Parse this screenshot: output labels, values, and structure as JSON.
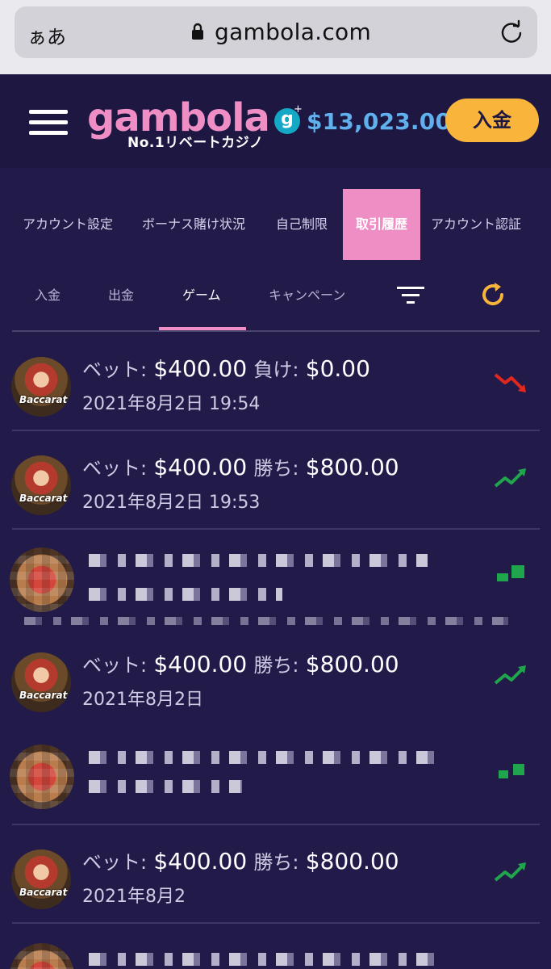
{
  "browser": {
    "text_size": "ぁあ",
    "url": "gambola.com"
  },
  "header": {
    "logo": "gambola",
    "tagline": "No.1リベートカジノ",
    "coin_letter": "g",
    "balance": "$13,023.00",
    "deposit_label": "入金"
  },
  "account_tabs": [
    {
      "label": "アカウント設定",
      "active": false
    },
    {
      "label": "ボーナス賭け状況",
      "active": false
    },
    {
      "label": "自己制限",
      "active": false
    },
    {
      "label": "取引履歴",
      "active": true
    },
    {
      "label": "アカウント認証",
      "active": false
    }
  ],
  "sub_tabs": [
    {
      "label": "入金",
      "active": false
    },
    {
      "label": "出金",
      "active": false
    },
    {
      "label": "ゲーム",
      "active": true
    },
    {
      "label": "キャンペーン",
      "active": false
    }
  ],
  "transactions": [
    {
      "game": "Baccarat",
      "bet_label": "ベット:",
      "bet": "$400.00",
      "result_label": "負け:",
      "result": "$0.00",
      "datetime": "2021年8月2日 19:54",
      "trend": "down",
      "trend_color": "#e0281e"
    },
    {
      "game": "Baccarat",
      "bet_label": "ベット:",
      "bet": "$400.00",
      "result_label": "勝ち:",
      "result": "$800.00",
      "datetime": "2021年8月2日 19:53",
      "trend": "up",
      "trend_color": "#1fa54b"
    },
    {
      "game": "Baccarat",
      "bet_label": "ベット:",
      "bet": "$400.00",
      "result_label": "勝ち:",
      "result": "$800.00",
      "datetime": "2021年8月2日",
      "trend": "up",
      "trend_color": "#1fa54b"
    },
    {
      "game": "Baccarat",
      "bet_label": "ベット:",
      "bet": "$400.00",
      "result_label": "勝ち:",
      "result": "$800.00",
      "datetime": "2021年8月2",
      "trend": "up",
      "trend_color": "#1fa54b"
    }
  ],
  "colors": {
    "background": "#221b49",
    "header": "#1d1742",
    "accent_pink": "#ee8ec4",
    "balance_blue": "#5fb0ec",
    "deposit_yellow": "#f8b43b",
    "win_green": "#1fa54b",
    "loss_red": "#e0281e"
  }
}
